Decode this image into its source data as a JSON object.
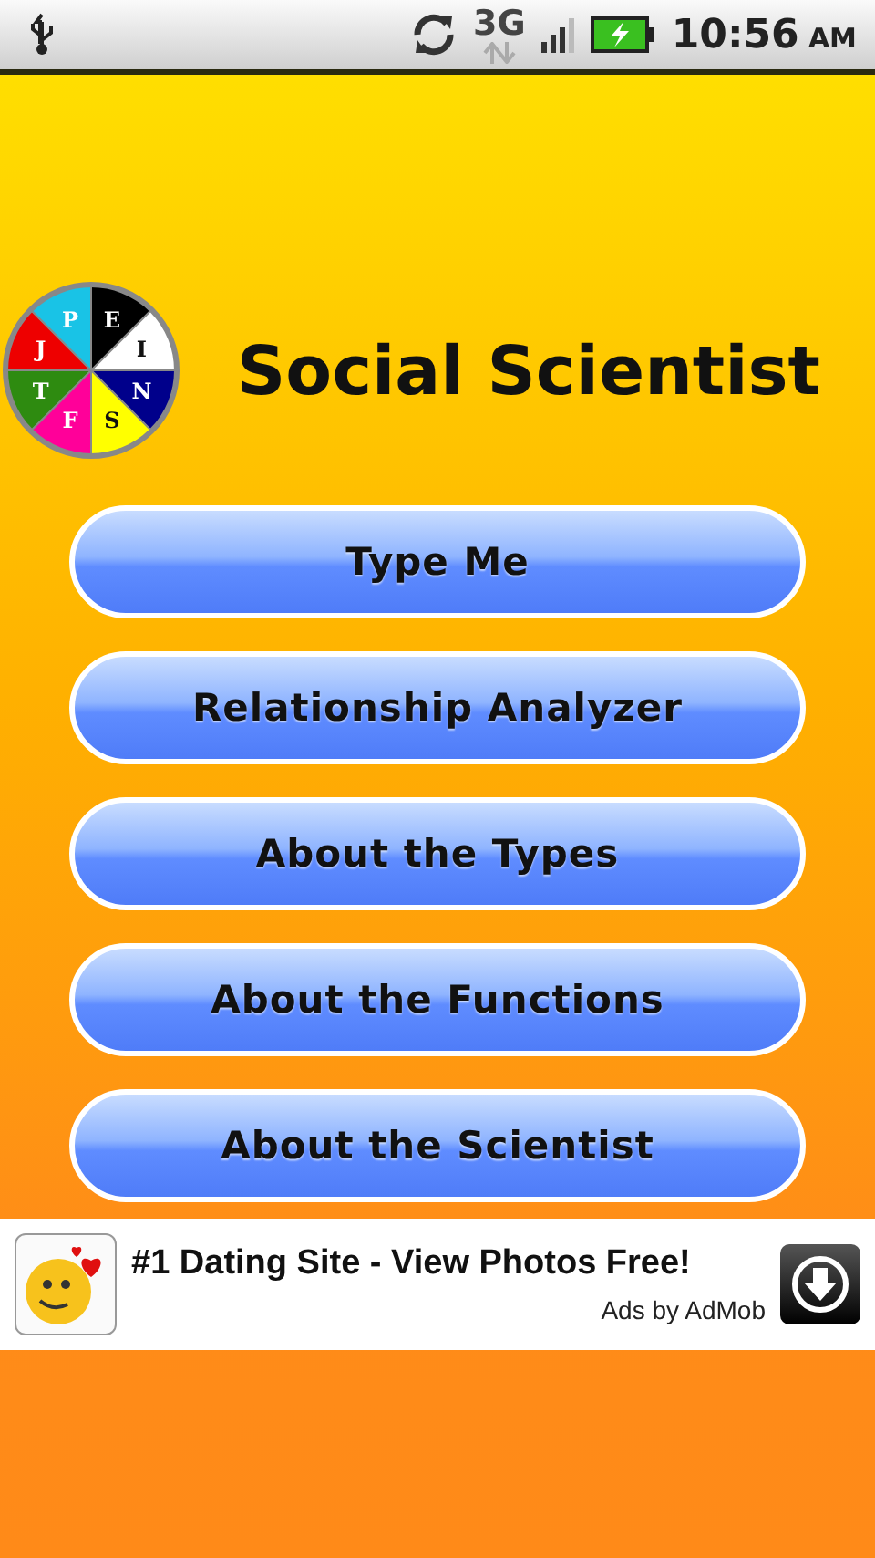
{
  "status_bar": {
    "network": "3G",
    "time": "10:56",
    "meridiem": "AM"
  },
  "logo": {
    "slices": [
      {
        "letter": "E",
        "color": "#000000"
      },
      {
        "letter": "I",
        "color": "#ffffff"
      },
      {
        "letter": "N",
        "color": "#00008b"
      },
      {
        "letter": "S",
        "color": "#ffff00"
      },
      {
        "letter": "F",
        "color": "#ff0099"
      },
      {
        "letter": "T",
        "color": "#2e8b10"
      },
      {
        "letter": "J",
        "color": "#ee0000"
      },
      {
        "letter": "P",
        "color": "#19c3e6"
      }
    ]
  },
  "title": "Social Scientist",
  "buttons": [
    "Type Me",
    "Relationship Analyzer",
    "About the Types",
    "About the Functions",
    "About the Scientist"
  ],
  "ad": {
    "headline": "#1 Dating Site - View Photos Free!",
    "attribution": "Ads by AdMob"
  }
}
